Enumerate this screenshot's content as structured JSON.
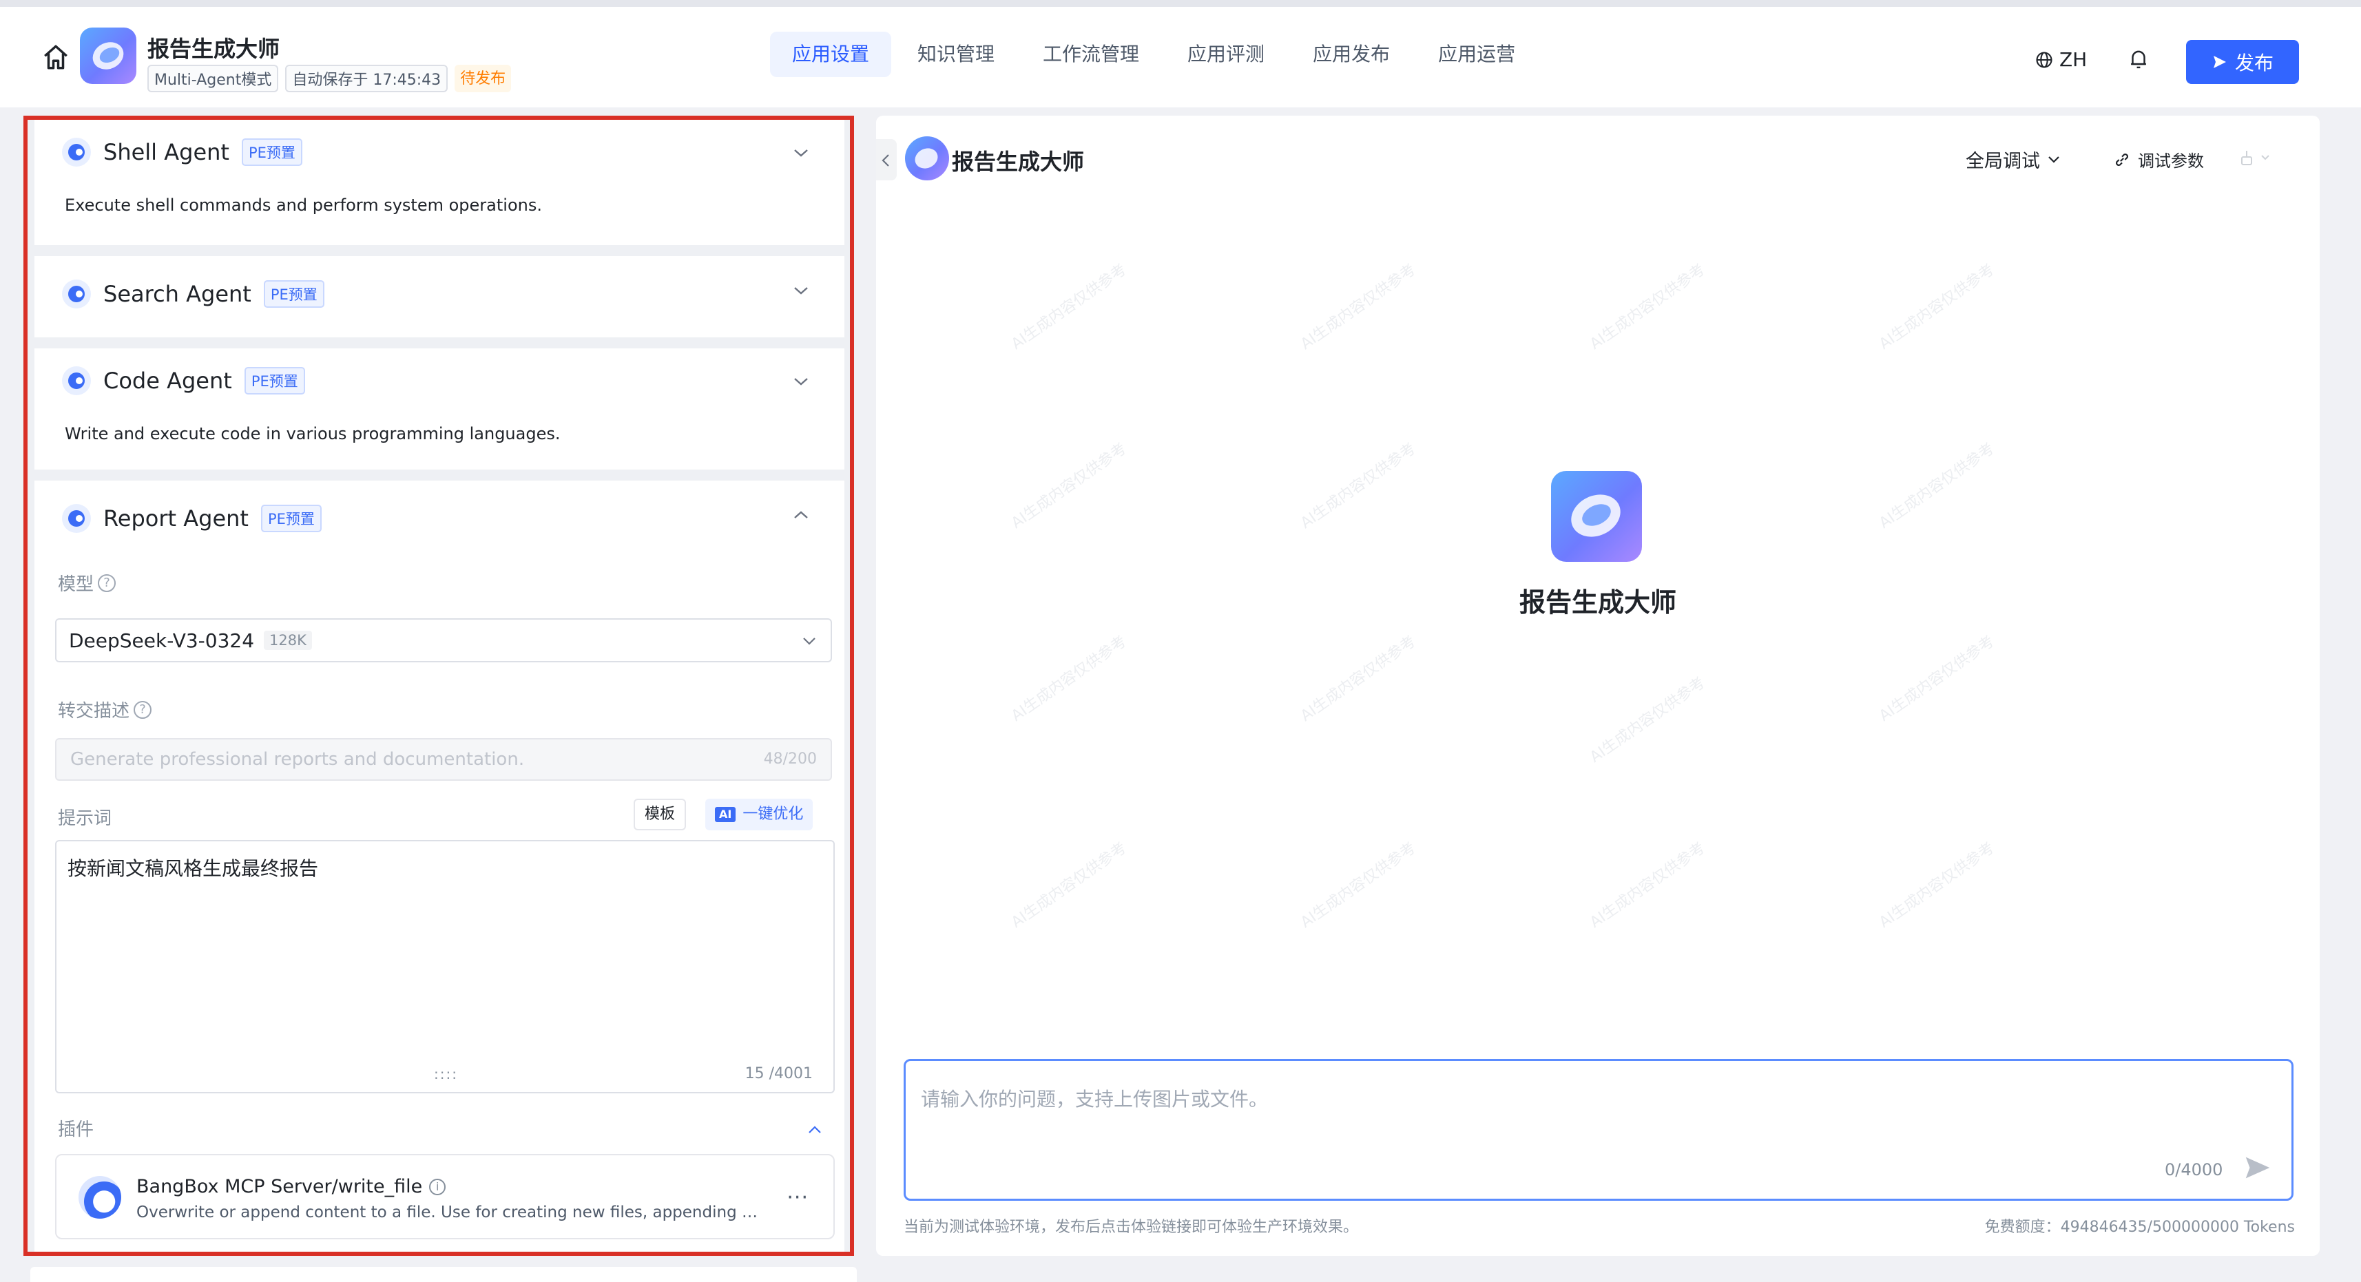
{
  "header": {
    "app_title": "报告生成大师",
    "mode_tag": "Multi-Agent模式",
    "autosave": "自动保存于 17:45:43",
    "status": "待发布",
    "nav": [
      {
        "label": "应用设置",
        "active": true
      },
      {
        "label": "知识管理",
        "active": false
      },
      {
        "label": "工作流管理",
        "active": false
      },
      {
        "label": "应用评测",
        "active": false
      },
      {
        "label": "应用发布",
        "active": false
      },
      {
        "label": "应用运营",
        "active": false
      }
    ],
    "lang": "ZH",
    "publish_label": "发布"
  },
  "agents": [
    {
      "name": "Shell Agent",
      "tag": "PE预置",
      "description": "Execute shell commands and perform system operations.",
      "expanded": false
    },
    {
      "name": "Search Agent",
      "tag": "PE预置",
      "description": "",
      "expanded": false
    },
    {
      "name": "Code Agent",
      "tag": "PE预置",
      "description": "Write and execute code in various programming languages.",
      "expanded": false
    },
    {
      "name": "Report Agent",
      "tag": "PE预置",
      "expanded": true
    }
  ],
  "report_agent": {
    "model_label": "模型",
    "model_name": "DeepSeek-V3-0324",
    "model_context": "128K",
    "handoff_label": "转交描述",
    "handoff_placeholder": "Generate professional reports and documentation.",
    "handoff_count": "48/200",
    "prompt_label": "提示词",
    "template_button": "模板",
    "ai_badge": "AI",
    "optimize_button": "一键优化",
    "prompt_text": "按新闻文稿风格生成最终报告",
    "prompt_count": "15 /4001",
    "resize_grip": "::::",
    "plugins_label": "插件",
    "plugin": {
      "name": "BangBox MCP Server/write_file",
      "description": "Overwrite or append content to a file. Use for creating new files, appending co...",
      "more": "···"
    }
  },
  "preview": {
    "title": "报告生成大师",
    "debug_mode": "全局调试",
    "debug_params": "调试参数",
    "center_title": "报告生成大师",
    "input_placeholder": "请输入你的问题，支持上传图片或文件。",
    "input_count": "0/4000",
    "footer_left": "当前为测试体验环境，发布后点击体验链接即可体验生产环境效果。",
    "footer_right": "免费额度：494846435/500000000 Tokens"
  },
  "colors": {
    "accent": "#3265ff",
    "highlight_border": "#d93026",
    "status_warn": "#ff7d00"
  }
}
